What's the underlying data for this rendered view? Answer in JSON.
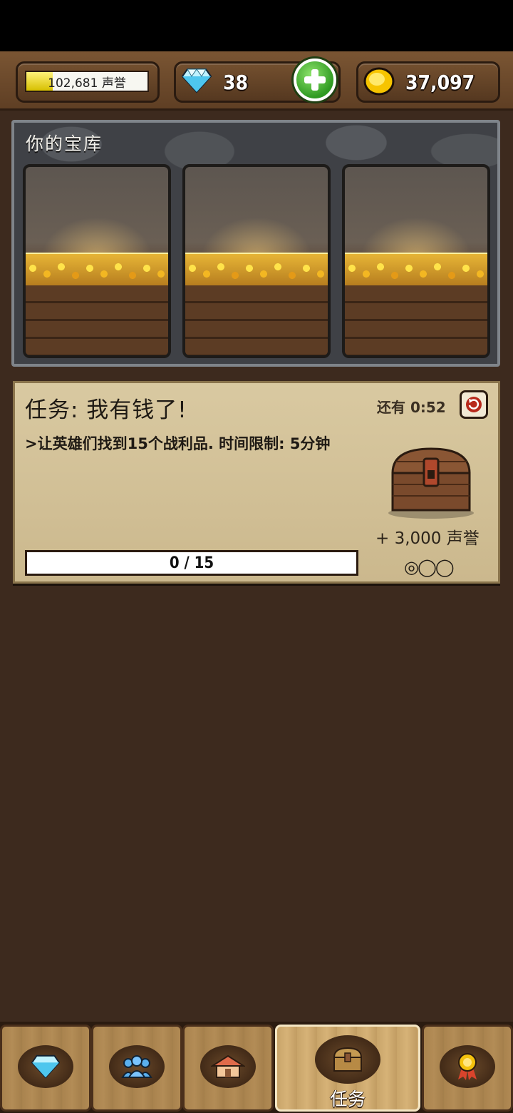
{
  "header": {
    "reputation": {
      "value_text": "102,681 声誉",
      "fill_fraction": 0.22
    },
    "gems": {
      "value": "38"
    },
    "gold": {
      "value": "37,097"
    }
  },
  "vault": {
    "title": "你的宝库",
    "slots": [
      {
        "icon": "gold-pile"
      },
      {
        "icon": "gold-pile"
      },
      {
        "icon": "gold-pile"
      }
    ]
  },
  "quest": {
    "title": "任务: 我有钱了!",
    "timer": "还有 0:52",
    "description": ">让英雄们找到15个战利品. 时间限制: 5分钟",
    "progress": {
      "text": "0 / 15",
      "current": 0,
      "total": 15
    },
    "reward": "+ 3,000 声誉",
    "rating": "◎◯◯"
  },
  "tabbar": {
    "tabs": [
      {
        "icon": "diamond-icon"
      },
      {
        "icon": "people-icon"
      },
      {
        "icon": "house-icon"
      },
      {
        "icon": "chest-icon",
        "label": "任务",
        "active": true
      },
      {
        "icon": "medal-icon"
      }
    ]
  },
  "colors": {
    "accent_green": "#2f9a22",
    "gold": "#e7b536",
    "parchment": "#d9c9a1",
    "wood": "#b38c56"
  }
}
